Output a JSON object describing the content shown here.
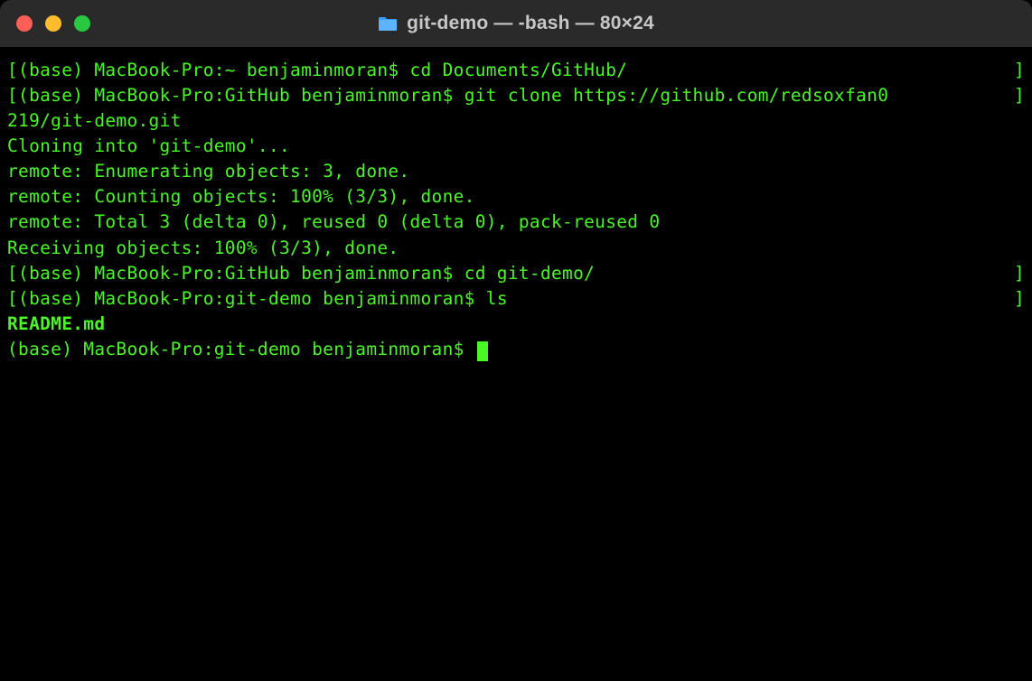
{
  "window": {
    "title": "git-demo — -bash — 80×24"
  },
  "terminal": {
    "lines": [
      {
        "type": "prompt",
        "bl": "[",
        "prompt": "(base) MacBook-Pro:~ benjaminmoran$ ",
        "cmd": "cd Documents/GitHub/",
        "br": "]"
      },
      {
        "type": "prompt",
        "bl": "[",
        "prompt": "(base) MacBook-Pro:GitHub benjaminmoran$ ",
        "cmd": "git clone https://github.com/redsoxfan0",
        "br": "]"
      },
      {
        "type": "cont",
        "text": "219/git-demo.git"
      },
      {
        "type": "output",
        "text": "Cloning into 'git-demo'..."
      },
      {
        "type": "output",
        "text": "remote: Enumerating objects: 3, done."
      },
      {
        "type": "output",
        "text": "remote: Counting objects: 100% (3/3), done."
      },
      {
        "type": "output",
        "text": "remote: Total 3 (delta 0), reused 0 (delta 0), pack-reused 0"
      },
      {
        "type": "output",
        "text": "Receiving objects: 100% (3/3), done."
      },
      {
        "type": "prompt",
        "bl": "[",
        "prompt": "(base) MacBook-Pro:GitHub benjaminmoran$ ",
        "cmd": "cd git-demo/",
        "br": "]"
      },
      {
        "type": "prompt",
        "bl": "[",
        "prompt": "(base) MacBook-Pro:git-demo benjaminmoran$ ",
        "cmd": "ls",
        "br": "]"
      },
      {
        "type": "output-bold",
        "text": "README.md"
      },
      {
        "type": "cursor-prompt",
        "prompt": "(base) MacBook-Pro:git-demo benjaminmoran$ "
      }
    ]
  }
}
